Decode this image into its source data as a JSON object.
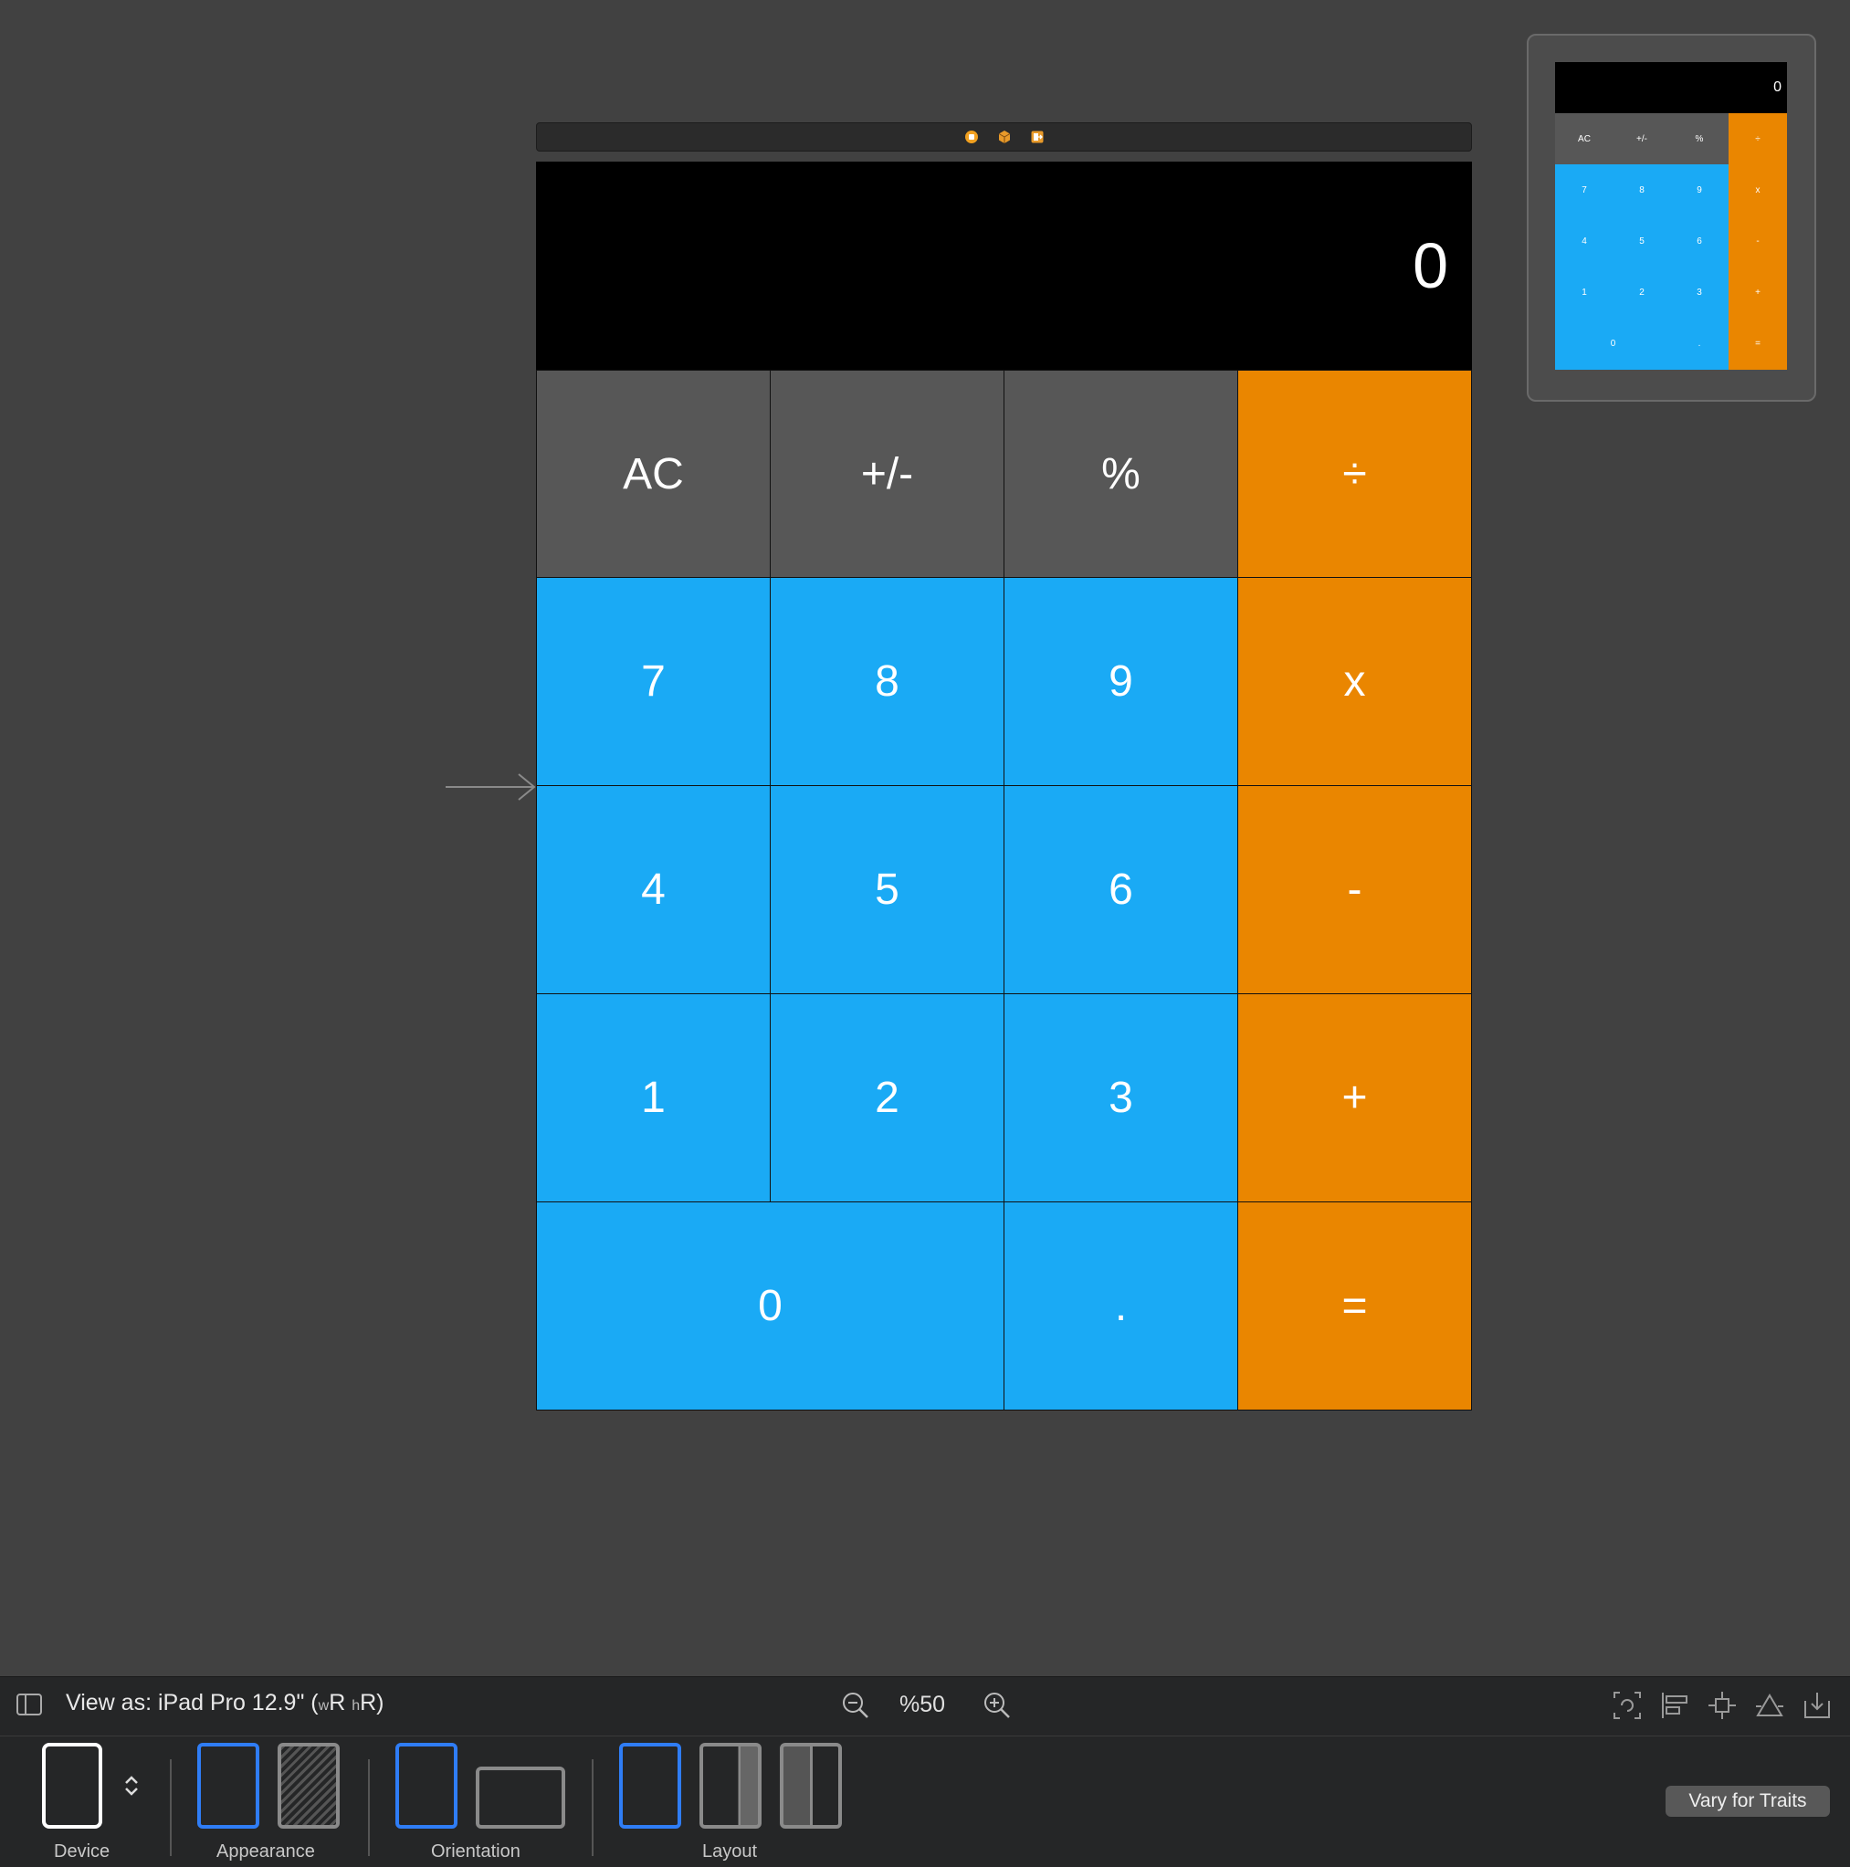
{
  "scene": {
    "bar_icons": [
      "view-controller-icon",
      "first-responder-icon",
      "exit-icon"
    ]
  },
  "calculator": {
    "display": "0",
    "keys": {
      "ac": "AC",
      "sign": "+/-",
      "percent": "%",
      "divide": "÷",
      "seven": "7",
      "eight": "8",
      "nine": "9",
      "multiply": "x",
      "four": "4",
      "five": "5",
      "six": "6",
      "minus": "-",
      "one": "1",
      "two": "2",
      "three": "3",
      "plus": "+",
      "zero": "0",
      "dot": ".",
      "equals": "="
    }
  },
  "bottom_bar": {
    "view_as_prefix": "View as: iPad Pro 12.9\"",
    "trait_w": "w",
    "trait_w_value": "R",
    "trait_h": "h",
    "trait_h_value": "R",
    "zoom": "%50",
    "labels": {
      "device": "Device",
      "appearance": "Appearance",
      "orientation": "Orientation",
      "layout": "Layout"
    },
    "vary_button": "Vary for Traits"
  },
  "colors": {
    "gray_key": "#575757",
    "blue_key": "#1aaaf5",
    "orange_key": "#ea8600",
    "canvas": "#414141",
    "selection": "#2f7df6"
  }
}
